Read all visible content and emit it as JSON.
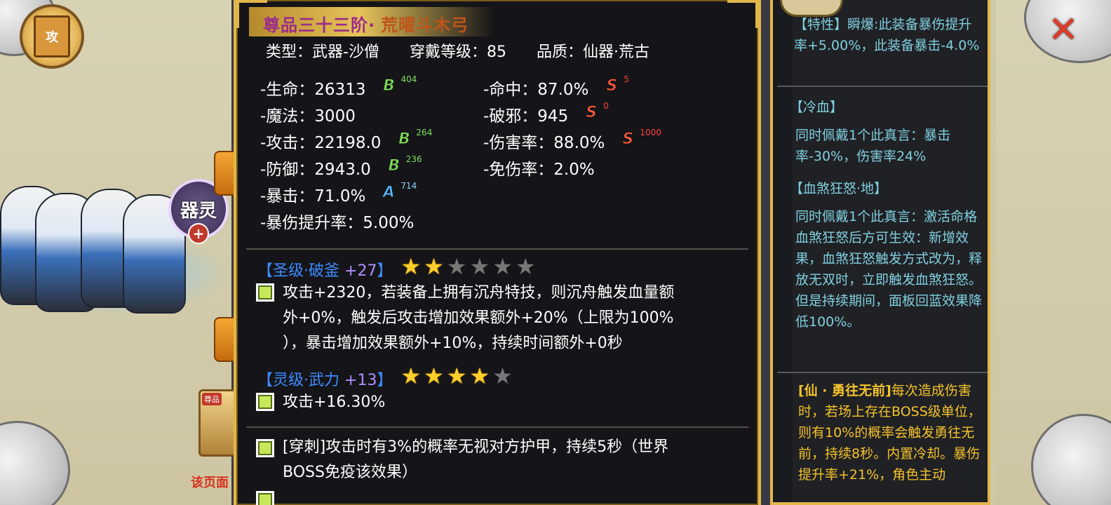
{
  "background": {
    "qiling_label": "器灵",
    "qiling_plus": "+",
    "book_label": "攻",
    "item_tag": "尊品",
    "red_note": "该页面"
  },
  "item": {
    "grade": "尊品三十三阶",
    "separator": "·",
    "name": "荒曜斗木弓",
    "type_text": "类型：武器-沙僧",
    "level_text": "穿戴等级：85",
    "quality_text": "品质：仙器·荒古"
  },
  "stats_left": [
    {
      "label": "-生命：26313",
      "badge": "B",
      "bonus": "404"
    },
    {
      "label": "-魔法：3000",
      "badge": "",
      "bonus": ""
    },
    {
      "label": "-攻击：22198.0",
      "badge": "B",
      "bonus": "264"
    },
    {
      "label": "-防御：2943.0",
      "badge": "B",
      "bonus": "236"
    },
    {
      "label": "-暴击：71.0%",
      "badge": "A",
      "bonus": "714"
    },
    {
      "label": "-暴伤提升率：5.00%",
      "badge": "",
      "bonus": ""
    }
  ],
  "stats_right": [
    {
      "label": "-命中：87.0%",
      "badge": "S",
      "bonus": "5"
    },
    {
      "label": "-破邪：945",
      "badge": "S",
      "bonus": "0"
    },
    {
      "label": "-伤害率：88.0%",
      "badge": "S",
      "bonus": "1000"
    },
    {
      "label": "-免伤率：2.0%",
      "badge": "",
      "bonus": ""
    }
  ],
  "enchants": [
    {
      "bracket_open": "【",
      "name": "圣级·破釜",
      "bracket_close": "】",
      "level": "+27",
      "stars_on": 2,
      "stars_total": 6,
      "lines": [
        "攻击+2320，若装备上拥有沉舟特技，则沉舟触发血量额",
        "外+0%，触发后攻击增加效果额外+20%（上限为100%",
        "），暴击增加效果额外+10%，持续时间额外+0秒"
      ]
    },
    {
      "bracket_open": "【",
      "name": "灵级·武力",
      "bracket_close": "】",
      "level": "+13",
      "stars_on": 4,
      "stars_total": 5,
      "lines": [
        "攻击+16.30%"
      ]
    }
  ],
  "skills": [
    {
      "lines": [
        "[穿刺]攻击时有3%的概率无视对方护甲，持续5秒（世界",
        "BOSS免疫该效果）"
      ]
    }
  ],
  "right_panel": {
    "trait_text": "【特性】瞬爆:此装备暴伤提升率+5.00%，此装备暴击-4.0%",
    "lengxue_title": "【冷血】",
    "lengxue_text": "同时佩戴1个此真言：暴击率-30%，伤害率24%",
    "xuesha_title": "【血煞狂怒·地】",
    "xuesha_text": "同时佩戴1个此真言：激活命格血煞狂怒后方可生效：新增效果，血煞狂怒触发方式改为，释放无双时，立即触发血煞狂怒。但是持续期间，面板回蓝效果降低100%。",
    "immortal_title": "[仙 · 勇往无前]",
    "immortal_text": "每次造成伤害时，若场上存在BOSS级单位，则有10%的概率会触发勇往无前，持续8秒。内置冷却。暴伤提升率+21%，角色主动"
  },
  "colors": {
    "gold_border": "#e2b64a",
    "cyan_text": "#7fd0df",
    "yellow_text": "#f4c22a",
    "grade_purple": "#9c2b8a",
    "name_orange": "#c0541a"
  },
  "icons": {
    "close": "close-icon",
    "star": "star-icon",
    "check": "checkbox-icon"
  }
}
